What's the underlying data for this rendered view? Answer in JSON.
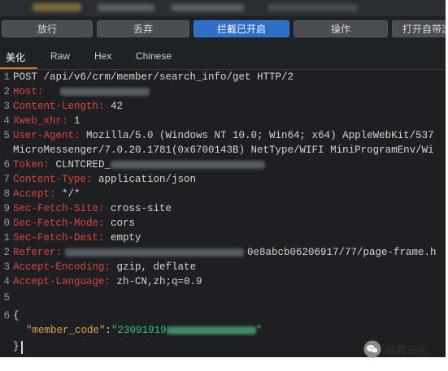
{
  "toolbar": {
    "buttons": [
      {
        "label": "放行"
      },
      {
        "label": "丢弃"
      },
      {
        "label": "拦截已开启"
      },
      {
        "label": "操作"
      },
      {
        "label": "打开自带浏"
      }
    ]
  },
  "tabs": [
    "美化",
    "Raw",
    "Hex",
    "Chinese"
  ],
  "lines": [
    {
      "n": "1",
      "text": "POST /api/v6/crm/member/search_info/get HTTP/2"
    },
    {
      "n": "2",
      "key": "Host:",
      "value": ""
    },
    {
      "n": "3",
      "key": "Content-Length:",
      "value": " 42"
    },
    {
      "n": "4",
      "key": "Xweb_xhr:",
      "value": " 1"
    },
    {
      "n": "5",
      "key": "User-Agent:",
      "value": " Mozilla/5.0 (Windows NT 10.0; Win64; x64) AppleWebKit/537"
    },
    {
      "n": "",
      "text": "MicroMessenger/7.0.20.1781(0x6700143B) NetType/WIFI MiniProgramEnv/Wi"
    },
    {
      "n": "6",
      "key": "Token:",
      "value": " CLNTCRED_"
    },
    {
      "n": "7",
      "key": "Content-Type:",
      "value": " application/json"
    },
    {
      "n": "8",
      "key": "Accept:",
      "value": " */*"
    },
    {
      "n": "9",
      "key": "Sec-Fetch-Site:",
      "value": " cross-site"
    },
    {
      "n": "0",
      "key": "Sec-Fetch-Mode:",
      "value": " cors"
    },
    {
      "n": "1",
      "key": "Sec-Fetch-Dest:",
      "value": " empty"
    },
    {
      "n": "2",
      "key": "Referer:",
      "value": "0e8abcb06206917/77/page-frame.h"
    },
    {
      "n": "3",
      "key": "Accept-Encoding:",
      "value": " gzip, deflate"
    },
    {
      "n": "4",
      "key": "Accept-Language:",
      "value": " zh-CN,zh;q=0.9"
    },
    {
      "n": "5",
      "text": ""
    },
    {
      "n": "6",
      "text": "{"
    },
    {
      "n": "",
      "key": "\"member_code\"",
      "value": "\"23091919"
    },
    {
      "n": "",
      "text": "}"
    }
  ],
  "watermark": {
    "text": "隐雾安全"
  },
  "colors": {
    "accent": "#2d6fc4",
    "header_key": "#e0443a",
    "json_key": "#e0a050",
    "json_string": "#3fbf7f"
  }
}
